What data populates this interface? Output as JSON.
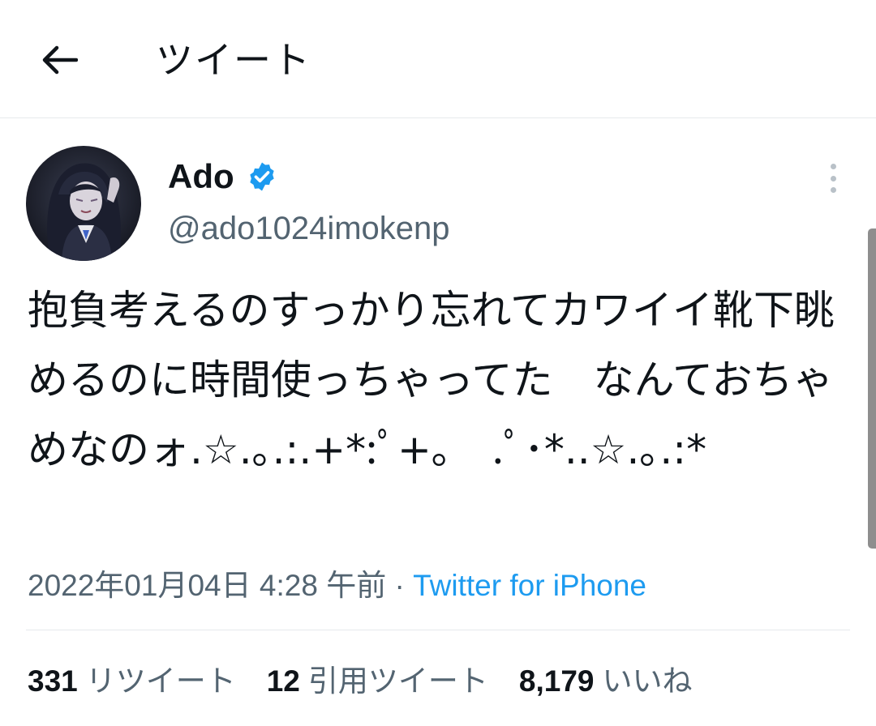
{
  "header": {
    "title": "ツイート",
    "back_icon": "arrow-left-icon"
  },
  "tweet": {
    "author": {
      "display_name": "Ado",
      "handle": "@ado1024imokenp",
      "verified_icon": "verified-badge-icon",
      "verified_color": "#1d9bf0"
    },
    "text": "抱負考えるのすっかり忘れてカワイイ靴下眺めるのに時間使っちゃってた　なんておちゃめなのォ.☆.｡.:.+*:ﾟ+｡　.ﾟ･*..☆.｡.:*",
    "timestamp": "2022年01月04日 4:28 午前",
    "separator": "·",
    "source": "Twitter for iPhone",
    "stats": {
      "retweets": {
        "count": "331",
        "label": "リツイート"
      },
      "quotes": {
        "count": "12",
        "label": "引用ツイート"
      },
      "likes": {
        "count": "8,179",
        "label": "いいね"
      }
    }
  },
  "colors": {
    "text_primary": "#0f1419",
    "text_secondary": "#536471",
    "link": "#1d9bf0",
    "divider": "#e6e9ec"
  }
}
